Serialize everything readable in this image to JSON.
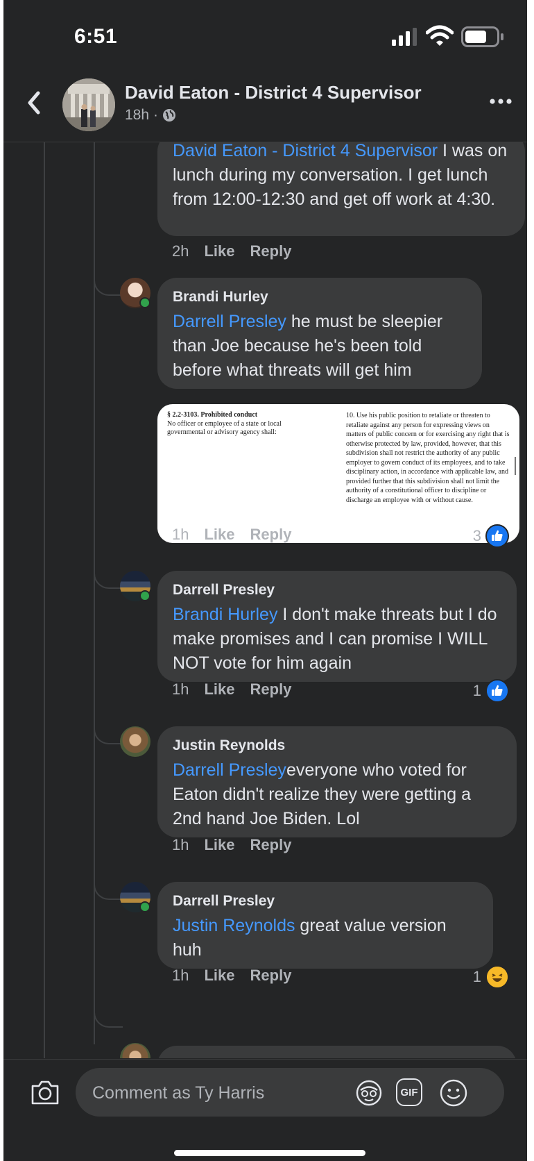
{
  "status_bar": {
    "time": "6:51"
  },
  "header": {
    "title": "David Eaton - District 4 Supervisor",
    "time": "18h",
    "separator": "·"
  },
  "comments": [
    {
      "id": "c1",
      "author": "",
      "mention": "David Eaton - District 4 Supervisor",
      "text": " I was on lunch during my conversation. I get lunch from 12:00-12:30 and get off work at 4:30.",
      "time": "2h",
      "like": "Like",
      "reply": "Reply"
    },
    {
      "id": "c2",
      "author": "Brandi Hurley",
      "mention": "Darrell Presley",
      "text": " he must be sleepier than Joe because he's been told before what threats will get him",
      "time": "1h",
      "like": "Like",
      "reply": "Reply",
      "reaction_count": "3",
      "reaction_icon": "like-icon"
    },
    {
      "id": "c3",
      "author": "Darrell Presley",
      "mention": "Brandi Hurley",
      "text": " I don't make threats but I do make promises and I can promise I WILL NOT vote for him again",
      "time": "1h",
      "like": "Like",
      "reply": "Reply",
      "reaction_count": "1",
      "reaction_icon": "like-icon"
    },
    {
      "id": "c4",
      "author": "Justin Reynolds",
      "mention": "Darrell Presley",
      "text": "everyone  who voted for Eaton didn't realize they were getting a 2nd hand Joe Biden. Lol",
      "time": "1h",
      "like": "Like",
      "reply": "Reply"
    },
    {
      "id": "c5",
      "author": "Darrell Presley",
      "mention": "Justin Reynolds",
      "text": " great value version huh",
      "time": "1h",
      "like": "Like",
      "reply": "Reply",
      "reaction_count": "1",
      "reaction_icon": "haha-icon"
    }
  ],
  "attachment": {
    "heading": "§ 2.2-3103. Prohibited conduct",
    "left_text": "No officer or employee of a state or local governmental or advisory agency shall:",
    "right_text": "10. Use his public position to retaliate or threaten to retaliate against any person for expressing views on matters of public concern or for exercising any right that is otherwise protected by law, provided, however, that this subdivision shall not restrict the authority of any public employer to govern conduct of its employees, and to take disciplinary action, in accordance with applicable law, and provided further that this subdivision shall not limit the authority of a constitutional officer to discipline or discharge an employee with or without cause."
  },
  "composer": {
    "placeholder": "Comment as Ty Harris",
    "gif_label": "GIF"
  },
  "colors": {
    "background": "#242526",
    "bubble": "#3a3b3c",
    "mention": "#4599ff",
    "like_blue": "#1877f2",
    "online_green": "#31a24c"
  }
}
